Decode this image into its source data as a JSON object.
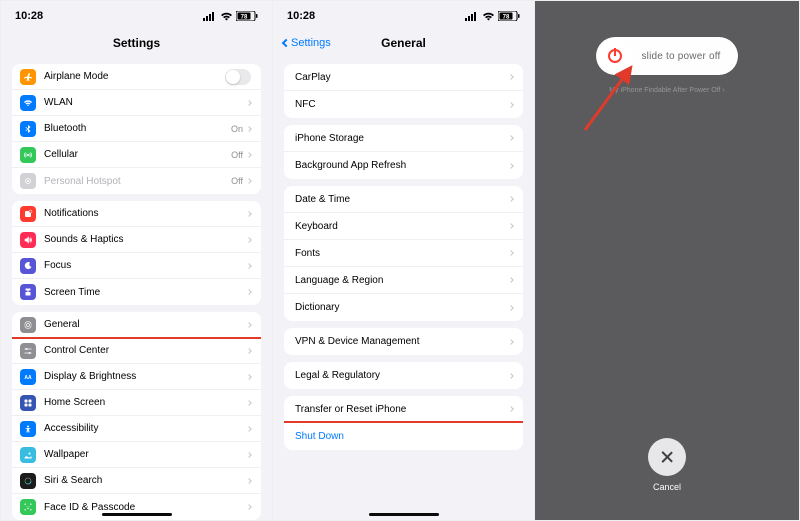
{
  "status": {
    "time": "10:28",
    "battery": "78"
  },
  "panel1": {
    "title": "Settings",
    "groups": [
      {
        "rows": [
          {
            "id": "airplane",
            "label": "Airplane Mode",
            "icon_bg": "#ff9500",
            "has_switch": true
          },
          {
            "id": "wlan",
            "label": "WLAN",
            "icon_bg": "#007aff",
            "has_chevron": true
          },
          {
            "id": "bluetooth",
            "label": "Bluetooth",
            "icon_bg": "#007aff",
            "detail": "On",
            "has_chevron": true
          },
          {
            "id": "cellular",
            "label": "Cellular",
            "icon_bg": "#34c759",
            "detail": "Off",
            "has_chevron": true
          },
          {
            "id": "hotspot",
            "label": "Personal Hotspot",
            "icon_bg": "#d1d1d6",
            "detail": "Off",
            "has_chevron": true,
            "dim": true
          }
        ]
      },
      {
        "rows": [
          {
            "id": "notifications",
            "label": "Notifications",
            "icon_bg": "#ff3b30",
            "has_chevron": true
          },
          {
            "id": "sounds",
            "label": "Sounds & Haptics",
            "icon_bg": "#ff2d55",
            "has_chevron": true
          },
          {
            "id": "focus",
            "label": "Focus",
            "icon_bg": "#5856d6",
            "has_chevron": true
          },
          {
            "id": "screen-time",
            "label": "Screen Time",
            "icon_bg": "#5856d6",
            "has_chevron": true
          }
        ]
      },
      {
        "rows": [
          {
            "id": "general",
            "label": "General",
            "icon_bg": "#8e8e93",
            "has_chevron": true,
            "highlight": true
          },
          {
            "id": "control-center",
            "label": "Control Center",
            "icon_bg": "#8e8e93",
            "has_chevron": true
          },
          {
            "id": "display",
            "label": "Display & Brightness",
            "icon_bg": "#007aff",
            "has_chevron": true
          },
          {
            "id": "home-screen",
            "label": "Home Screen",
            "icon_bg": "#3655b3",
            "has_chevron": true
          },
          {
            "id": "accessibility",
            "label": "Accessibility",
            "icon_bg": "#007aff",
            "has_chevron": true
          },
          {
            "id": "wallpaper",
            "label": "Wallpaper",
            "icon_bg": "#38bde1",
            "has_chevron": true
          },
          {
            "id": "siri",
            "label": "Siri & Search",
            "icon_bg": "#1c1c1e",
            "has_chevron": true
          },
          {
            "id": "faceid",
            "label": "Face ID & Passcode",
            "icon_bg": "#34c759",
            "has_chevron": true
          }
        ]
      }
    ]
  },
  "panel2": {
    "back": "Settings",
    "title": "General",
    "groups": [
      {
        "rows": [
          {
            "id": "carplay",
            "label": "CarPlay",
            "has_chevron": true
          },
          {
            "id": "nfc",
            "label": "NFC",
            "has_chevron": true
          }
        ]
      },
      {
        "rows": [
          {
            "id": "storage",
            "label": "iPhone Storage",
            "has_chevron": true
          },
          {
            "id": "bg-refresh",
            "label": "Background App Refresh",
            "has_chevron": true
          }
        ]
      },
      {
        "rows": [
          {
            "id": "datetime",
            "label": "Date & Time",
            "has_chevron": true
          },
          {
            "id": "keyboard",
            "label": "Keyboard",
            "has_chevron": true
          },
          {
            "id": "fonts",
            "label": "Fonts",
            "has_chevron": true
          },
          {
            "id": "lang",
            "label": "Language & Region",
            "has_chevron": true
          },
          {
            "id": "dict",
            "label": "Dictionary",
            "has_chevron": true
          }
        ]
      },
      {
        "rows": [
          {
            "id": "vpn",
            "label": "VPN & Device Management",
            "has_chevron": true
          }
        ]
      },
      {
        "rows": [
          {
            "id": "legal",
            "label": "Legal & Regulatory",
            "has_chevron": true
          }
        ]
      },
      {
        "rows": [
          {
            "id": "reset",
            "label": "Transfer or Reset iPhone",
            "has_chevron": true
          },
          {
            "id": "shutdown",
            "label": "Shut Down",
            "blue": true,
            "highlight": true
          }
        ]
      }
    ]
  },
  "panel3": {
    "slide_label": "slide to power off",
    "hint": "My iPhone Findable After Power Off ›",
    "cancel": "Cancel"
  },
  "colors": {
    "ios_blue": "#007aff",
    "red_arrow": "#e23a2a",
    "power_red": "#ff3b30"
  }
}
